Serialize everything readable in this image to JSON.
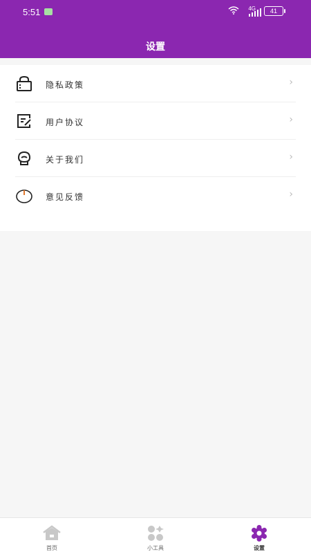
{
  "status_bar": {
    "time": "5:51",
    "network": "4G",
    "battery": "41"
  },
  "header": {
    "title": "设置"
  },
  "settings": {
    "items": [
      {
        "label": "隐私政策",
        "icon": "lock-icon"
      },
      {
        "label": "用户协议",
        "icon": "edit-document-icon"
      },
      {
        "label": "关于我们",
        "icon": "info-mascot-icon"
      },
      {
        "label": "意见反馈",
        "icon": "power-icon"
      }
    ]
  },
  "tabbar": {
    "tabs": [
      {
        "label": "首页",
        "icon": "home-icon"
      },
      {
        "label": "小工具",
        "icon": "tools-icon"
      },
      {
        "label": "设置",
        "icon": "gear-icon"
      }
    ],
    "active_index": 2
  },
  "colors": {
    "primary": "#8b27b0",
    "background": "#f6f6f6",
    "inactive_icon": "#c8c8c8"
  }
}
